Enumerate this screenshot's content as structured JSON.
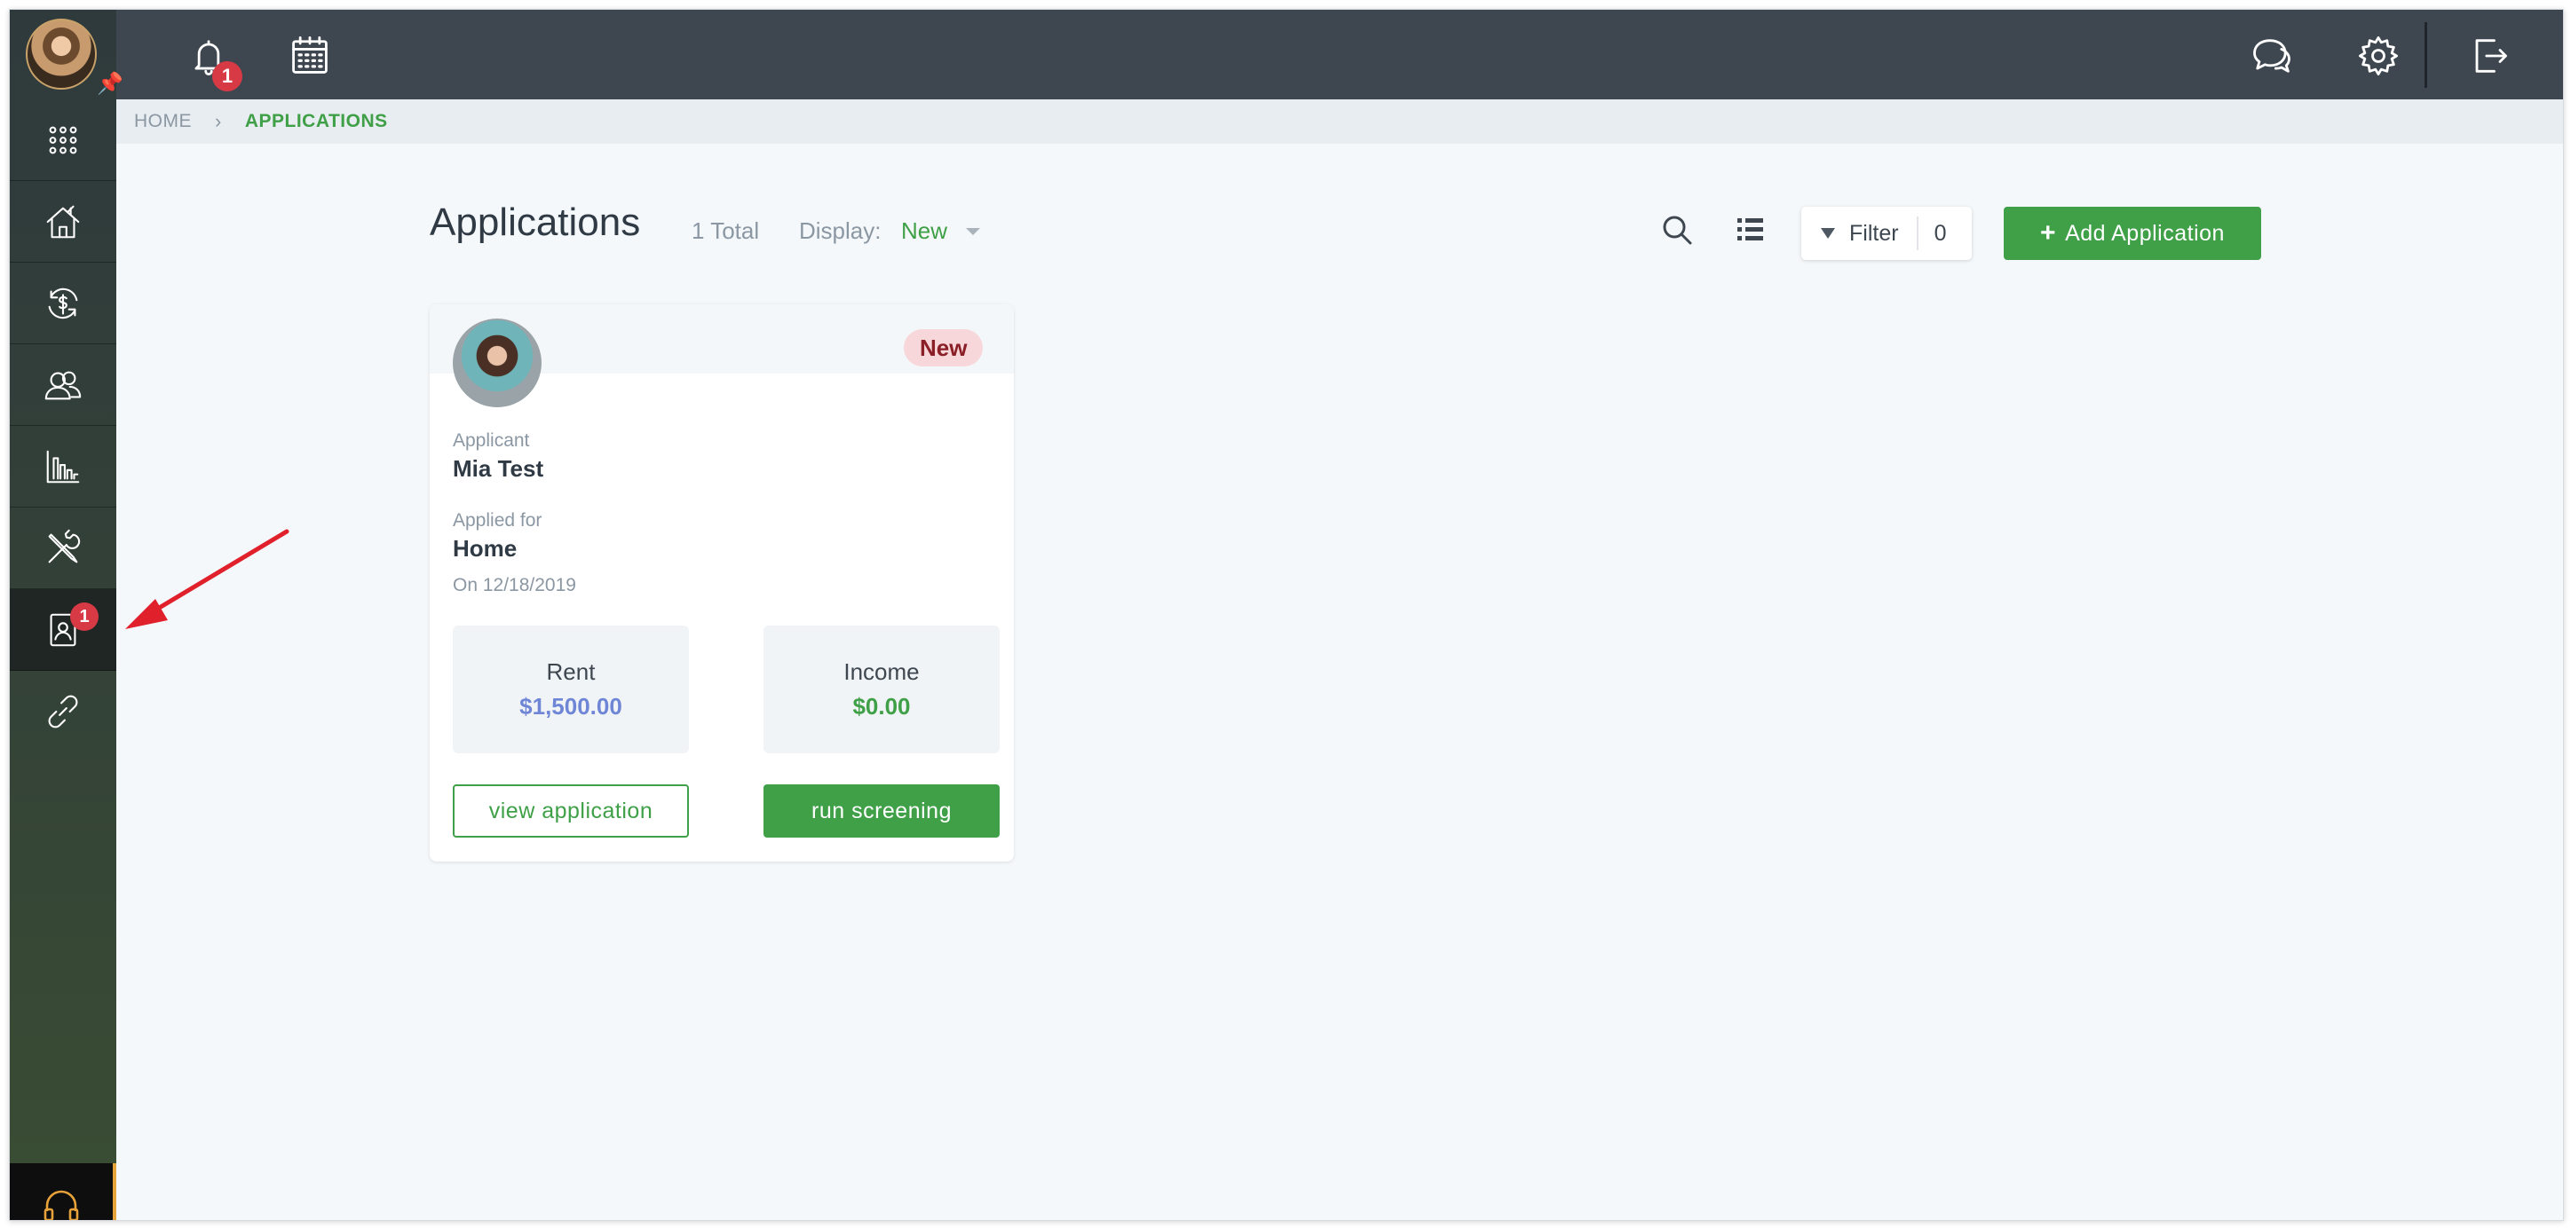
{
  "topbar": {
    "notifications_count": "1",
    "icons": [
      "bell-icon",
      "calendar-icon",
      "chat-icon",
      "gear-icon",
      "logout-icon"
    ]
  },
  "sidebar": {
    "items": [
      {
        "name": "apps-grid",
        "icon": "grid-icon"
      },
      {
        "name": "properties",
        "icon": "home-icon"
      },
      {
        "name": "accounting",
        "icon": "dollar-cycle-icon"
      },
      {
        "name": "people",
        "icon": "users-icon"
      },
      {
        "name": "reports",
        "icon": "chart-icon"
      },
      {
        "name": "maintenance",
        "icon": "tools-icon"
      },
      {
        "name": "applications",
        "icon": "applicant-icon",
        "badge": "1",
        "active": true
      },
      {
        "name": "integrations",
        "icon": "link-icon"
      }
    ],
    "support_icon": "headset-icon"
  },
  "breadcrumb": {
    "home": "HOME",
    "current": "APPLICATIONS"
  },
  "header": {
    "title": "Applications",
    "total": "1 Total",
    "display_label": "Display:",
    "display_value": "New",
    "filter_label": "Filter",
    "filter_count": "0",
    "add_button": "Add Application",
    "add_plus": "+"
  },
  "card": {
    "status": "New",
    "applicant_label": "Applicant",
    "applicant_name": "Mia Test",
    "applied_for_label": "Applied for",
    "applied_for": "Home",
    "applied_on": "On 12/18/2019",
    "rent_label": "Rent",
    "rent_value": "$1,500.00",
    "income_label": "Income",
    "income_value": "$0.00",
    "view_button": "view application",
    "screen_button": "run screening"
  },
  "colors": {
    "topbar": "#3e4750",
    "accent_green": "#3fa047",
    "badge_red": "#d83a45",
    "rent_blue": "#6f86d6",
    "annotation_red": "#e0202a"
  }
}
